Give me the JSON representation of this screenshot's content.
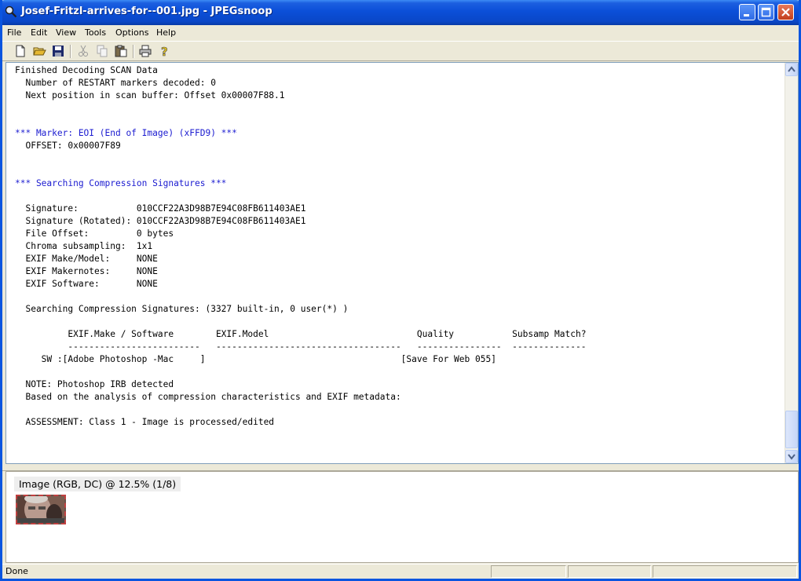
{
  "window": {
    "title": "Josef-Fritzl-arrives-for--001.jpg - JPEGsnoop",
    "colors": {
      "titlebar": "#0a4fd8",
      "log_text_blue": "#1a1ad0",
      "thumb_border": "#c04040"
    }
  },
  "menu": {
    "file": "File",
    "edit": "Edit",
    "view": "View",
    "tools": "Tools",
    "options": "Options",
    "help": "Help"
  },
  "toolbar": {
    "icons": [
      "new-document-icon",
      "open-folder-icon",
      "save-icon",
      "cut-icon",
      "copy-icon",
      "paste-icon",
      "print-icon",
      "help-icon"
    ]
  },
  "log": {
    "lines": [
      {
        "text": "Finished Decoding SCAN Data",
        "style": "normal"
      },
      {
        "text": "  Number of RESTART markers decoded: 0",
        "style": "normal"
      },
      {
        "text": "  Next position in scan buffer: Offset 0x00007F88.1",
        "style": "normal"
      },
      {
        "text": "",
        "style": "normal"
      },
      {
        "text": "",
        "style": "normal"
      },
      {
        "text": "*** Marker: EOI (End of Image) (xFFD9) ***",
        "style": "blue",
        "indent": "none"
      },
      {
        "text": "  OFFSET: 0x00007F89",
        "style": "normal",
        "indent": "none"
      },
      {
        "text": "",
        "style": "normal"
      },
      {
        "text": "",
        "style": "normal"
      },
      {
        "text": "*** Searching Compression Signatures ***",
        "style": "blue",
        "indent": "none"
      },
      {
        "text": "",
        "style": "normal"
      },
      {
        "text": "  Signature:           010CCF22A3D98B7E94C08FB611403AE1",
        "style": "normal",
        "indent": "none"
      },
      {
        "text": "  Signature (Rotated): 010CCF22A3D98B7E94C08FB611403AE1",
        "style": "normal",
        "indent": "none"
      },
      {
        "text": "  File Offset:         0 bytes",
        "style": "normal",
        "indent": "none"
      },
      {
        "text": "  Chroma subsampling:  1x1",
        "style": "normal",
        "indent": "none"
      },
      {
        "text": "  EXIF Make/Model:     NONE",
        "style": "normal",
        "indent": "none"
      },
      {
        "text": "  EXIF Makernotes:     NONE",
        "style": "normal",
        "indent": "none"
      },
      {
        "text": "  EXIF Software:       NONE",
        "style": "normal",
        "indent": "none"
      },
      {
        "text": "",
        "style": "normal"
      },
      {
        "text": "  Searching Compression Signatures: (3327 built-in, 0 user(*) )",
        "style": "normal",
        "indent": "none"
      },
      {
        "text": "",
        "style": "normal"
      },
      {
        "text": "          EXIF.Make / Software        EXIF.Model                            Quality           Subsamp Match?",
        "style": "normal",
        "indent": "none"
      },
      {
        "text": "          -------------------------   -----------------------------------   ----------------  --------------",
        "style": "normal",
        "indent": "none"
      },
      {
        "text": "     SW :[Adobe Photoshop -Mac     ]                                     [Save For Web 055]",
        "style": "normal",
        "indent": "none"
      },
      {
        "text": "",
        "style": "normal"
      },
      {
        "text": "  NOTE: Photoshop IRB detected",
        "style": "normal",
        "indent": "none"
      },
      {
        "text": "  Based on the analysis of compression characteristics and EXIF metadata:",
        "style": "normal",
        "indent": "none"
      },
      {
        "text": "",
        "style": "normal"
      },
      {
        "text": "  ASSESSMENT: Class 1 - Image is processed/edited",
        "style": "normal",
        "indent": "none"
      }
    ]
  },
  "image_pane": {
    "label": "Image (RGB, DC) @ 12.5% (1/8)"
  },
  "status": {
    "text": "Done"
  }
}
